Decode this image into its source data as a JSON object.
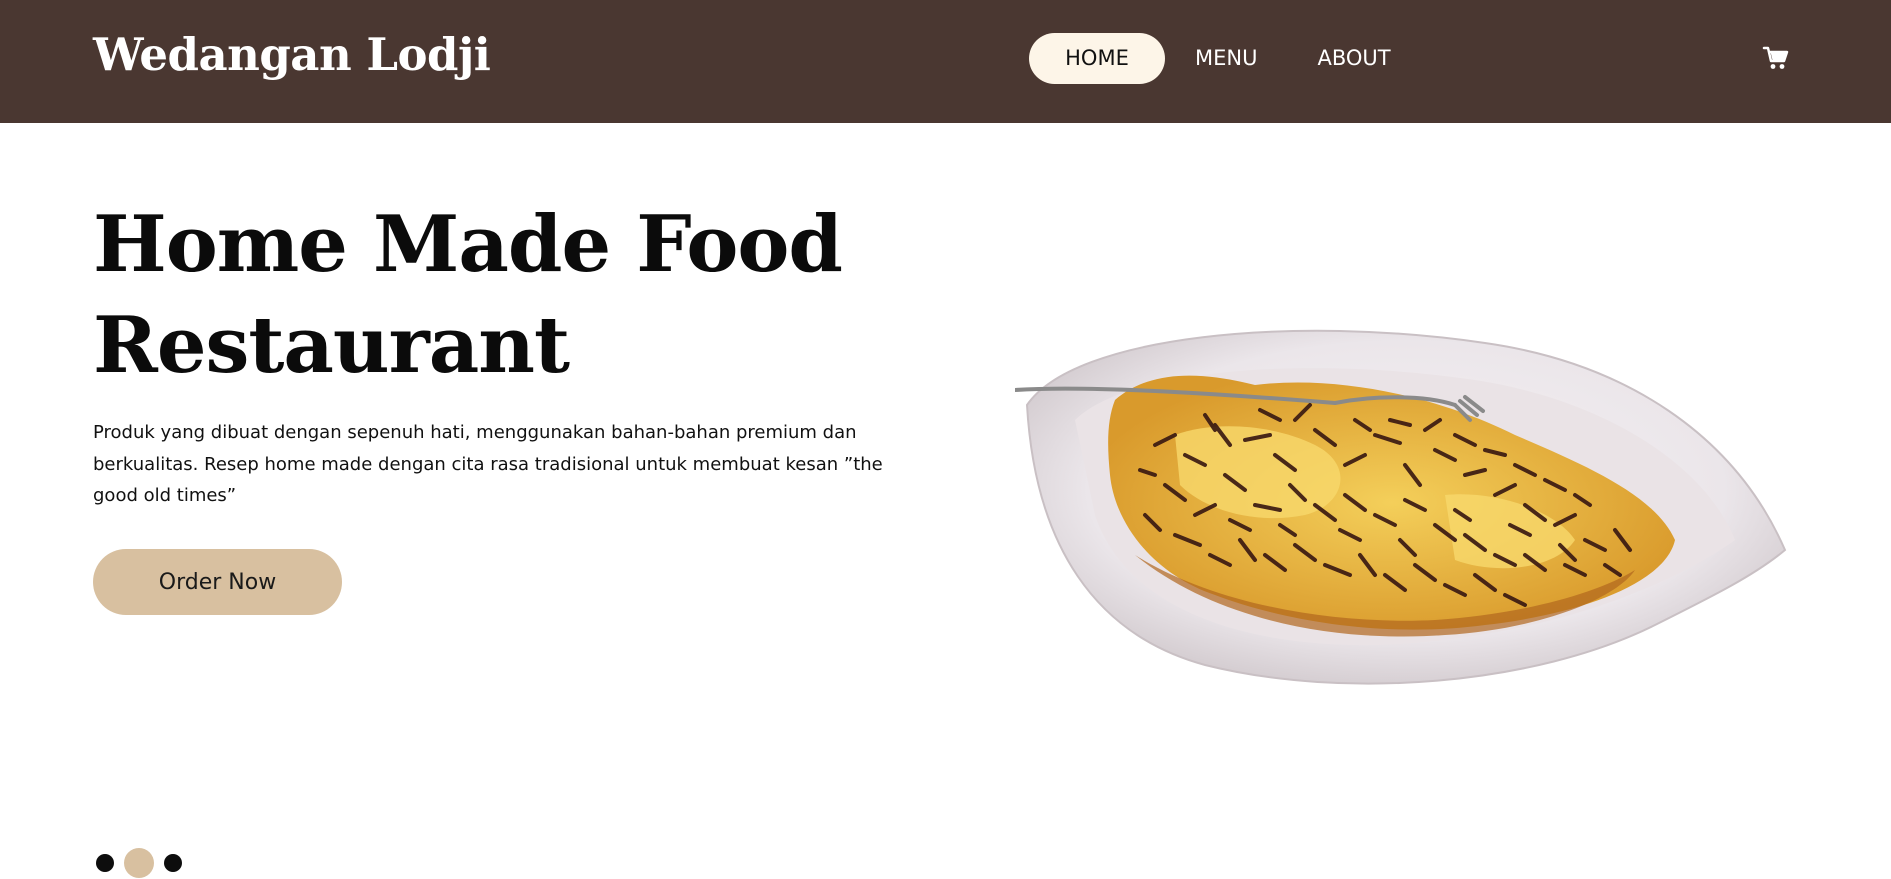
{
  "navbar": {
    "brand": "Wedangan Lodji",
    "links": [
      {
        "label": "HOME",
        "active": true
      },
      {
        "label": "MENU",
        "active": false
      },
      {
        "label": "ABOUT",
        "active": false
      }
    ],
    "cart_icon": "cart-icon"
  },
  "hero": {
    "title_line1": "Home Made Food",
    "title_line2": "Restaurant",
    "description": "Produk yang dibuat dengan sepenuh hati, menggunakan bahan-bahan premium dan berkualitas. Resep home made dengan cita rasa tradisional untuk membuat kesan ”the good old times”",
    "cta_label": "Order Now",
    "image_icon": "food-plate-image"
  },
  "carousel": {
    "dot_count": 3,
    "active_index": 1
  },
  "colors": {
    "navbar_bg": "#4a3731",
    "active_pill": "#fdf5e8",
    "accent": "#d8c0a0",
    "text": "#111111"
  }
}
